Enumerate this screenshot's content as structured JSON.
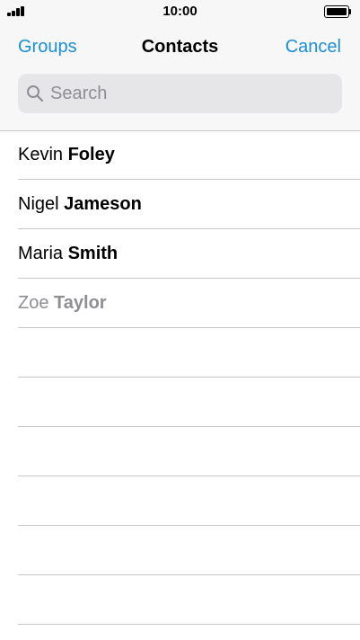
{
  "status_bar": {
    "time": "10:00",
    "signal_icon": "cellular-signal-icon",
    "battery_icon": "battery-full-icon"
  },
  "nav": {
    "left_label": "Groups",
    "title": "Contacts",
    "right_label": "Cancel"
  },
  "search": {
    "placeholder": "Search",
    "value": "",
    "icon": "search-icon"
  },
  "contacts": [
    {
      "first": "Kevin",
      "last": "Foley",
      "dimmed": false
    },
    {
      "first": "Nigel",
      "last": "Jameson",
      "dimmed": false
    },
    {
      "first": "Maria",
      "last": "Smith",
      "dimmed": false
    },
    {
      "first": "Zoe",
      "last": "Taylor",
      "dimmed": true
    }
  ],
  "colors": {
    "accent": "#1a8fd7",
    "dimmed_text": "#8e8e93",
    "separator": "#c8c7cc",
    "search_background": "#e6e6e8"
  }
}
